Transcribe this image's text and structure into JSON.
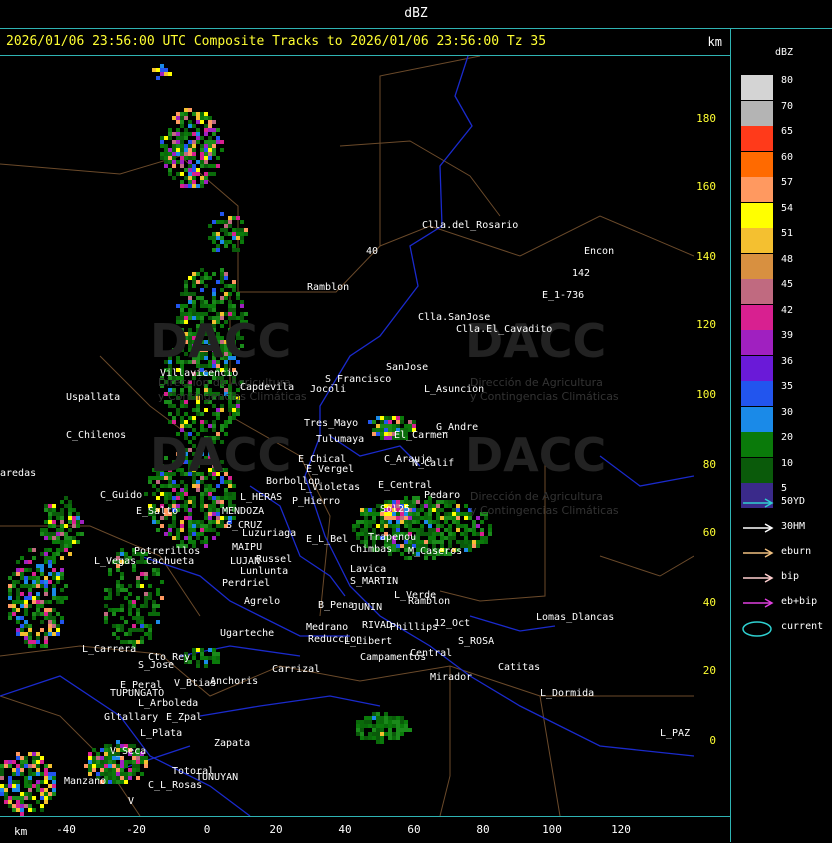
{
  "window": {
    "title": "dBZ"
  },
  "header": {
    "title": "2026/01/06 23:56:00 UTC Composite Tracks to 2026/01/06 23:56:00 Tz 35",
    "unit": "km"
  },
  "legend": {
    "title": "dBZ",
    "scale": [
      {
        "label": "80",
        "color": "#d4d4d4"
      },
      {
        "label": "70",
        "color": "#b4b4b4"
      },
      {
        "label": "65",
        "color": "#ff3a1a"
      },
      {
        "label": "60",
        "color": "#ff6a00"
      },
      {
        "label": "57",
        "color": "#ff9960"
      },
      {
        "label": "54",
        "color": "#ffff00"
      },
      {
        "label": "51",
        "color": "#f4c030"
      },
      {
        "label": "48",
        "color": "#d89040"
      },
      {
        "label": "45",
        "color": "#c06a80"
      },
      {
        "label": "42",
        "color": "#d82090"
      },
      {
        "label": "39",
        "color": "#a020c0"
      },
      {
        "label": "36",
        "color": "#6a1ad8"
      },
      {
        "label": "35",
        "color": "#2255ee"
      },
      {
        "label": "30",
        "color": "#1a8ae8"
      },
      {
        "label": "20",
        "color": "#0a7a0a"
      },
      {
        "label": "10",
        "color": "#0a5a0a"
      },
      {
        "label": "5",
        "color": "#3a2a8a"
      }
    ],
    "tracks": [
      {
        "label": "50YD",
        "color": "#2fd0d0"
      },
      {
        "label": "30HM",
        "color": "#ffffff"
      },
      {
        "label": "eburn",
        "color": "#f0c080"
      },
      {
        "label": "bip",
        "color": "#ffd0d0"
      },
      {
        "label": "eb+bip",
        "color": "#e040e0"
      }
    ],
    "current_label": "current",
    "current_color": "#2fd0d0"
  },
  "axes": {
    "x_unit": "km",
    "x_ticks": [
      "-40",
      "-20",
      "0",
      "20",
      "40",
      "60",
      "80",
      "100",
      "120"
    ],
    "y_ticks": [
      "180",
      "160",
      "140",
      "120",
      "100",
      "80",
      "60",
      "40",
      "20",
      "0"
    ]
  },
  "watermark": {
    "brand": "DACC",
    "line1": "Dirección de Agricultura",
    "line2": "y Contingencias Climáticas"
  },
  "places": [
    "Clla.del_Rosario",
    "Encon",
    "142",
    "E_1-736",
    "Ramblon",
    "Clla.SanJose",
    "Clla.El_Cavadito",
    "40",
    "S_Francisco",
    "SanJose",
    "L_Asuncion",
    "Villavicencio",
    "Capdevila",
    "Jocoli",
    "Uspallata",
    "Tres_Mayo",
    "Tulumaya",
    "G_Andre",
    "El_Carmen",
    "C_Chilenos",
    "E_Chical",
    "C_Araujo",
    "N_Calif",
    "E_Vergel",
    "Borbollon",
    "L_Violetas",
    "E_Central",
    "Pedaro",
    "aredas",
    "C_Guido",
    "L_HERAS",
    "P_Hierro",
    "Sol25",
    "E_Salto",
    "MENDOZA",
    "S_CRUZ",
    "Luzuriaga",
    "E_L_Bel",
    "Trapenou",
    "Chimbas",
    "M_Caseros",
    "MAIPU",
    "Russel",
    "Potrerillos",
    "L_Vegas",
    "Cachueta",
    "LUJAN",
    "Lunlunta",
    "Perdriel",
    "Lavica",
    "S_MARTIN",
    "Agrelo",
    "B_Pena",
    "JUNIN",
    "L_Verde",
    "Ramblon",
    "Lomas_Dlancas",
    "Ugarteche",
    "Medrano",
    "RIVAD",
    "Phillips",
    "12_Oct",
    "S_ROSA",
    "L_Carrera",
    "Cto_Rey",
    "Reduccion",
    "L_Libert",
    "Central",
    "S_Jose",
    "Carrizal",
    "Campamentos",
    "Catitas",
    "E_Peral",
    "V_Btias",
    "Anchoris",
    "TUPUNGATO",
    "Mirador",
    "L_Dormida",
    "L_Arboleda",
    "Gltallary",
    "E_Zpal",
    "L_Plata",
    "Zapata",
    "L_PAZ",
    "V_Seca",
    "Totoral",
    "TUNUYAN",
    "Manzano",
    "C_L_Rosas",
    "V"
  ]
}
